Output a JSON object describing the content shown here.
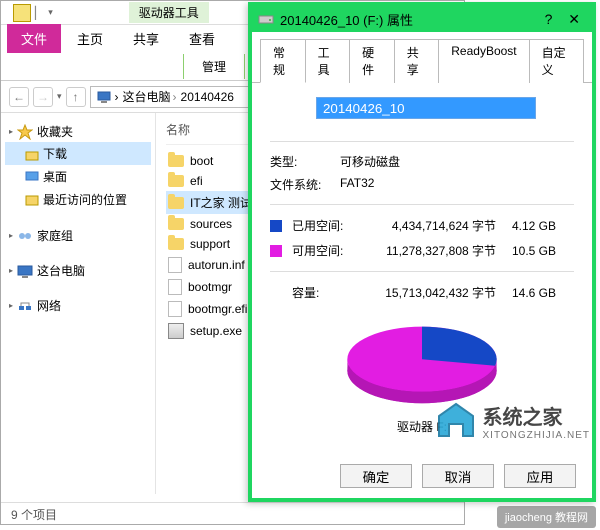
{
  "explorer": {
    "title_context": "驱动器工具",
    "title_main": "20140426_10 (F:)",
    "tabs": {
      "file": "文件",
      "home": "主页",
      "share": "共享",
      "view": "查看",
      "manage": "管理"
    },
    "crumbs": [
      "这台电脑",
      "20140426"
    ],
    "sidebar": {
      "favorites": {
        "label": "收藏夹",
        "items": [
          "下载",
          "桌面",
          "最近访问的位置"
        ]
      },
      "homegroup": "家庭组",
      "thispc": "这台电脑",
      "network": "网络"
    },
    "columns": {
      "name": "名称"
    },
    "files": [
      {
        "name": "boot",
        "type": "folder"
      },
      {
        "name": "efi",
        "type": "folder"
      },
      {
        "name": "IT之家 测试U盘",
        "type": "folder",
        "selected": true
      },
      {
        "name": "sources",
        "type": "folder"
      },
      {
        "name": "support",
        "type": "folder"
      },
      {
        "name": "autorun.inf",
        "type": "file"
      },
      {
        "name": "bootmgr",
        "type": "file"
      },
      {
        "name": "bootmgr.efi",
        "type": "file"
      },
      {
        "name": "setup.exe",
        "type": "exe"
      }
    ],
    "status": "9 个项目"
  },
  "props": {
    "title": "20140426_10 (F:) 属性",
    "tabs": [
      "常规",
      "工具",
      "硬件",
      "共享",
      "ReadyBoost",
      "自定义"
    ],
    "drive_name": "20140426_10",
    "type_label": "类型:",
    "type_val": "可移动磁盘",
    "fs_label": "文件系统:",
    "fs_val": "FAT32",
    "used_label": "已用空间:",
    "used_bytes": "4,434,714,624 字节",
    "used_size": "4.12 GB",
    "used_color": "#1548c6",
    "free_label": "可用空间:",
    "free_bytes": "11,278,327,808 字节",
    "free_size": "10.5 GB",
    "free_color": "#e21de2",
    "cap_label": "容量:",
    "cap_bytes": "15,713,042,432 字节",
    "cap_size": "14.6 GB",
    "pie_caption": "驱动器 F:",
    "btn_ok": "确定",
    "btn_cancel": "取消",
    "btn_apply": "应用"
  },
  "watermark": {
    "big": "系统之家",
    "small": "XITONGZHIJIA.NET",
    "corner": "jiaocheng 教程网"
  },
  "chart_data": {
    "type": "pie",
    "title": "驱动器 F:",
    "series": [
      {
        "name": "已用空间",
        "value": 4434714624,
        "display": "4.12 GB",
        "color": "#1548c6"
      },
      {
        "name": "可用空间",
        "value": 11278327808,
        "display": "10.5 GB",
        "color": "#e21de2"
      }
    ],
    "total": 15713042432
  }
}
